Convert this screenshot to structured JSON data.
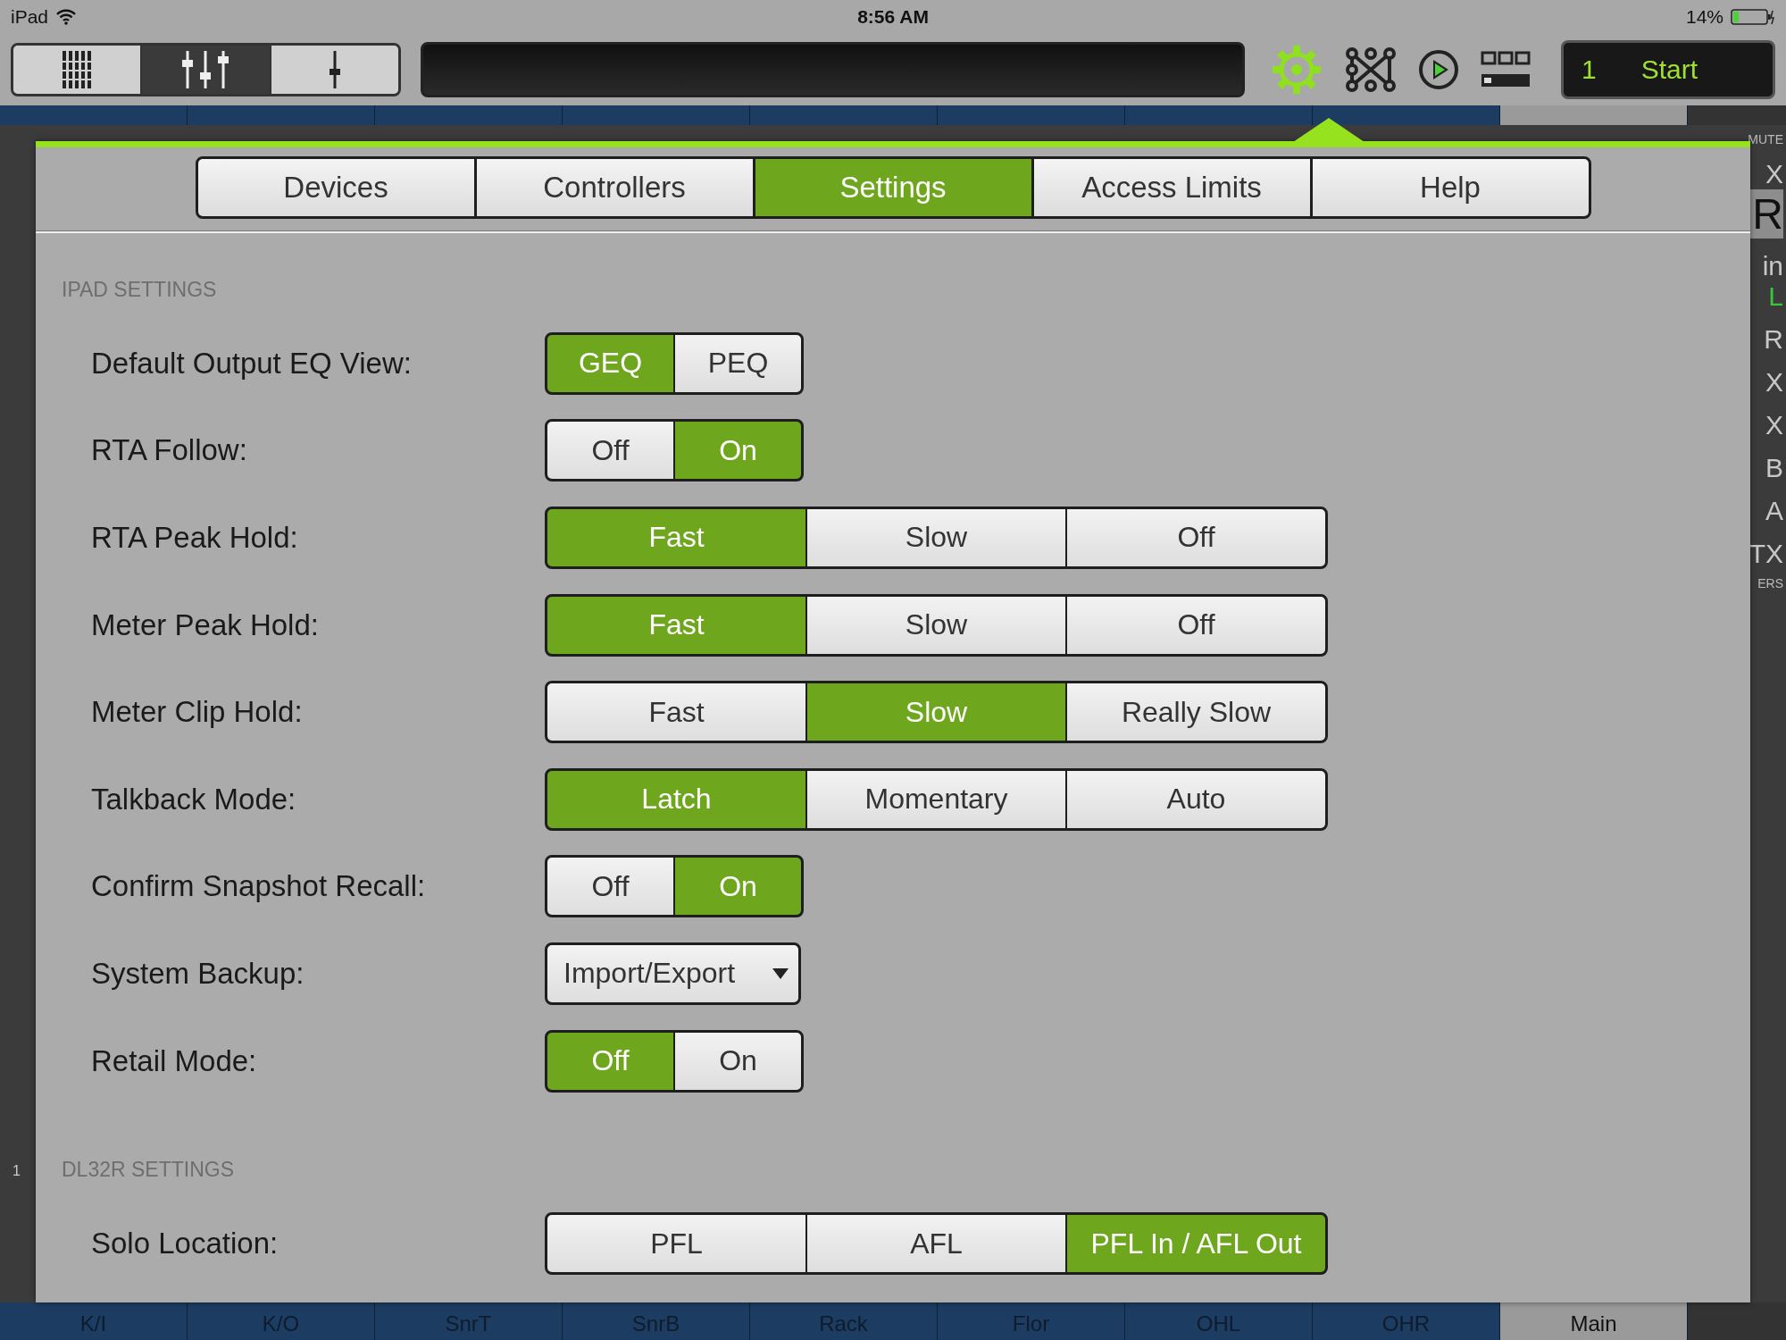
{
  "status_bar": {
    "device": "iPad",
    "time": "8:56 AM",
    "battery": "14%"
  },
  "toolbar": {
    "view_modes": [
      {
        "kind": "channels",
        "selected": false
      },
      {
        "kind": "faders",
        "selected": true
      },
      {
        "kind": "single",
        "selected": false
      }
    ],
    "settings_active": true,
    "snapshot": {
      "number": "1",
      "name": "Start"
    }
  },
  "mixer_background": {
    "channels": [
      {
        "name": "K/I",
        "selected": false
      },
      {
        "name": "K/O",
        "selected": false
      },
      {
        "name": "SnrT",
        "selected": false
      },
      {
        "name": "SnrB",
        "selected": false
      },
      {
        "name": "Rack",
        "selected": false
      },
      {
        "name": "Flor",
        "selected": false
      },
      {
        "name": "OHL",
        "selected": false
      },
      {
        "name": "OHR",
        "selected": false
      },
      {
        "name": "Main",
        "selected": true
      }
    ],
    "right_strip": [
      {
        "text": "MUTE",
        "kind": "label"
      },
      {
        "text": "X",
        "kind": "letter"
      },
      {
        "text": "R",
        "kind": "big"
      },
      {
        "text": "in",
        "kind": "letter"
      },
      {
        "text": "L",
        "kind": "green"
      },
      {
        "text": "R",
        "kind": "letter"
      },
      {
        "text": "X",
        "kind": "letter"
      },
      {
        "text": "X",
        "kind": "letter"
      },
      {
        "text": "B",
        "kind": "letter"
      },
      {
        "text": "A",
        "kind": "letter"
      },
      {
        "text": "TX",
        "kind": "letter"
      },
      {
        "text": "ERS",
        "kind": "label"
      }
    ],
    "left_strip": "1"
  },
  "tabs": [
    {
      "label": "Devices",
      "selected": false
    },
    {
      "label": "Controllers",
      "selected": false
    },
    {
      "label": "Settings",
      "selected": true
    },
    {
      "label": "Access Limits",
      "selected": false
    },
    {
      "label": "Help",
      "selected": false
    }
  ],
  "sections": [
    {
      "title": "IPAD SETTINGS",
      "rows": [
        {
          "label": "Default Output EQ View:",
          "kind": "segmented",
          "options": [
            {
              "label": "GEQ",
              "selected": true
            },
            {
              "label": "PEQ",
              "selected": false
            }
          ]
        },
        {
          "label": "RTA Follow:",
          "kind": "segmented",
          "options": [
            {
              "label": "Off",
              "selected": false
            },
            {
              "label": "On",
              "selected": true
            }
          ]
        },
        {
          "label": "RTA Peak Hold:",
          "kind": "segmented",
          "options": [
            {
              "label": "Fast",
              "selected": true
            },
            {
              "label": "Slow",
              "selected": false
            },
            {
              "label": "Off",
              "selected": false
            }
          ]
        },
        {
          "label": "Meter Peak Hold:",
          "kind": "segmented",
          "options": [
            {
              "label": "Fast",
              "selected": true
            },
            {
              "label": "Slow",
              "selected": false
            },
            {
              "label": "Off",
              "selected": false
            }
          ]
        },
        {
          "label": "Meter Clip Hold:",
          "kind": "segmented",
          "options": [
            {
              "label": "Fast",
              "selected": false
            },
            {
              "label": "Slow",
              "selected": true
            },
            {
              "label": "Really Slow",
              "selected": false
            }
          ]
        },
        {
          "label": "Talkback Mode:",
          "kind": "segmented",
          "options": [
            {
              "label": "Latch",
              "selected": true
            },
            {
              "label": "Momentary",
              "selected": false
            },
            {
              "label": "Auto",
              "selected": false
            }
          ]
        },
        {
          "label": "Confirm Snapshot Recall:",
          "kind": "segmented",
          "options": [
            {
              "label": "Off",
              "selected": false
            },
            {
              "label": "On",
              "selected": true
            }
          ]
        },
        {
          "label": "System Backup:",
          "kind": "dropdown",
          "value": "Import/Export"
        },
        {
          "label": "Retail Mode:",
          "kind": "segmented",
          "options": [
            {
              "label": "Off",
              "selected": true
            },
            {
              "label": "On",
              "selected": false
            }
          ]
        }
      ]
    },
    {
      "title": "DL32R SETTINGS",
      "rows": [
        {
          "label": "Solo Location:",
          "kind": "segmented",
          "options": [
            {
              "label": "PFL",
              "selected": false
            },
            {
              "label": "AFL",
              "selected": false
            },
            {
              "label": "PFL In / AFL Out",
              "selected": true
            }
          ]
        }
      ]
    }
  ]
}
